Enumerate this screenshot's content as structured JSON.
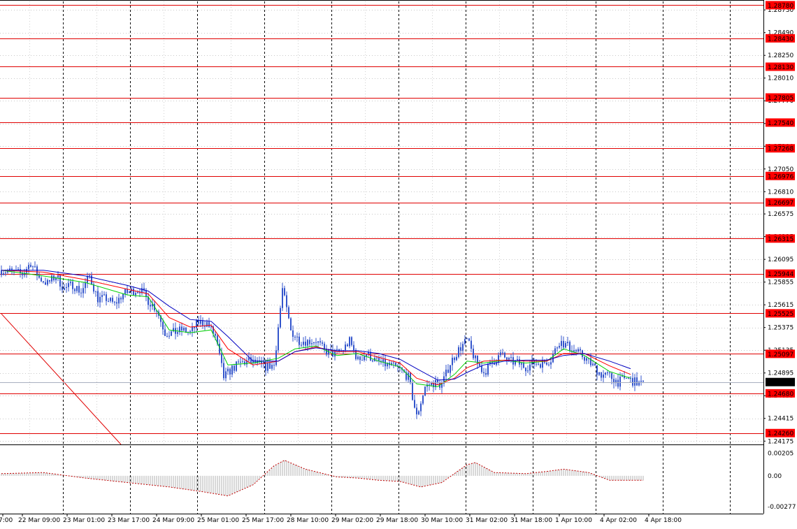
{
  "chart_data": {
    "type": "candlestick",
    "grid": true,
    "price_axis": {
      "range": [
        1.2414,
        1.2882
      ],
      "tick_labels": [
        1.2873,
        1.2849,
        1.2825,
        1.2801,
        1.2777,
        1.2753,
        1.2729,
        1.2705,
        1.2681,
        1.26575,
        1.26335,
        1.26095,
        1.25855,
        1.25615,
        1.25375,
        1.25135,
        1.24895,
        1.24655,
        1.24415,
        1.24175
      ],
      "tick_text": [
        "1.28730",
        "1.28490",
        "1.28250",
        "1.28010",
        "1.27770",
        "1.27530",
        "1.27290",
        "1.27050",
        "1.26810",
        "1.26575",
        "1.26335",
        "1.26095",
        "1.25855",
        "1.25615",
        "1.25375",
        "1.25135",
        "1.24895",
        "1.24655",
        "1.24415",
        "1.24175"
      ]
    },
    "time_axis": {
      "labels": [
        "7:00",
        "22 Mar 09:00",
        "23 Mar 01:00",
        "23 Mar 17:00",
        "24 Mar 09:00",
        "25 Mar 01:00",
        "25 Mar 17:00",
        "28 Mar 10:00",
        "29 Mar 02:00",
        "29 Mar 18:00",
        "30 Mar 10:00",
        "31 Mar 02:00",
        "31 Mar 18:00",
        "1 Apr 10:00",
        "4 Apr 02:00",
        "4 Apr 18:00"
      ]
    },
    "levels": [
      {
        "value": 1.2878,
        "label": "1.28780"
      },
      {
        "value": 1.2843,
        "label": "1.28430"
      },
      {
        "value": 1.2813,
        "label": "1.28130"
      },
      {
        "value": 1.27805,
        "label": "1.27805"
      },
      {
        "value": 1.2754,
        "label": "1.27540"
      },
      {
        "value": 1.27268,
        "label": "1.27268"
      },
      {
        "value": 1.26976,
        "label": "1.26976"
      },
      {
        "value": 1.26697,
        "label": "1.26697"
      },
      {
        "value": 1.26315,
        "label": "1.26315"
      },
      {
        "value": 1.25944,
        "label": "1.25944"
      },
      {
        "value": 1.25525,
        "label": "1.25525"
      },
      {
        "value": 1.25097,
        "label": "1.25097"
      },
      {
        "value": 1.2468,
        "label": "1.24680"
      },
      {
        "value": 1.2426,
        "label": "1.24260"
      }
    ],
    "current_price": {
      "value": 1.24799,
      "label": "1.24799"
    },
    "trendline": {
      "from": [
        0,
        1.2552
      ],
      "to": [
        57,
        1.2414
      ]
    },
    "price_path": [
      [
        0,
        1.2598
      ],
      [
        6,
        1.2596
      ],
      [
        10,
        1.2594
      ],
      [
        14,
        1.2606
      ],
      [
        18,
        1.259
      ],
      [
        22,
        1.2584
      ],
      [
        26,
        1.2592
      ],
      [
        30,
        1.2578
      ],
      [
        34,
        1.2583
      ],
      [
        38,
        1.2575
      ],
      [
        42,
        1.2592
      ],
      [
        46,
        1.2568
      ],
      [
        50,
        1.2568
      ],
      [
        54,
        1.2562
      ],
      [
        58,
        1.2573
      ],
      [
        62,
        1.2576
      ],
      [
        66,
        1.2578
      ],
      [
        70,
        1.2566
      ],
      [
        74,
        1.2557
      ],
      [
        78,
        1.2532
      ],
      [
        82,
        1.2532
      ],
      [
        86,
        1.2535
      ],
      [
        90,
        1.2532
      ],
      [
        94,
        1.2543
      ],
      [
        98,
        1.2542
      ],
      [
        102,
        1.2528
      ],
      [
        106,
        1.2485
      ],
      [
        110,
        1.2494
      ],
      [
        114,
        1.25
      ],
      [
        118,
        1.2502
      ],
      [
        122,
        1.2499
      ],
      [
        126,
        1.2496
      ],
      [
        130,
        1.2498
      ],
      [
        134,
        1.2578
      ],
      [
        138,
        1.2534
      ],
      [
        142,
        1.2524
      ],
      [
        146,
        1.2523
      ],
      [
        150,
        1.2524
      ],
      [
        154,
        1.2513
      ],
      [
        158,
        1.251
      ],
      [
        162,
        1.2512
      ],
      [
        166,
        1.2523
      ],
      [
        170,
        1.2503
      ],
      [
        174,
        1.251
      ],
      [
        178,
        1.2503
      ],
      [
        182,
        1.2499
      ],
      [
        186,
        1.2497
      ],
      [
        190,
        1.2493
      ],
      [
        194,
        1.2485
      ],
      [
        198,
        1.2443
      ],
      [
        202,
        1.2475
      ],
      [
        206,
        1.2479
      ],
      [
        210,
        1.2477
      ],
      [
        214,
        1.25
      ],
      [
        218,
        1.2514
      ],
      [
        222,
        1.2524
      ],
      [
        226,
        1.2503
      ],
      [
        230,
        1.249
      ],
      [
        234,
        1.25
      ],
      [
        238,
        1.2509
      ],
      [
        242,
        1.2502
      ],
      [
        246,
        1.25
      ],
      [
        250,
        1.2496
      ],
      [
        254,
        1.25
      ],
      [
        258,
        1.25
      ],
      [
        262,
        1.2504
      ],
      [
        266,
        1.2523
      ],
      [
        270,
        1.2518
      ],
      [
        274,
        1.2512
      ],
      [
        278,
        1.2506
      ],
      [
        282,
        1.2497
      ],
      [
        286,
        1.2488
      ],
      [
        290,
        1.2486
      ],
      [
        294,
        1.248
      ],
      [
        298,
        1.2484
      ],
      [
        302,
        1.248
      ],
      [
        306,
        1.2477
      ]
    ],
    "moving_averages": [
      {
        "color": "#00d000",
        "points": [
          [
            0,
            1.2598
          ],
          [
            20,
            1.2592
          ],
          [
            40,
            1.2585
          ],
          [
            60,
            1.2572
          ],
          [
            70,
            1.257
          ],
          [
            80,
            1.2535
          ],
          [
            90,
            1.2532
          ],
          [
            100,
            1.2535
          ],
          [
            108,
            1.2498
          ],
          [
            120,
            1.25
          ],
          [
            132,
            1.2505
          ],
          [
            140,
            1.2515
          ],
          [
            150,
            1.2518
          ],
          [
            160,
            1.2508
          ],
          [
            170,
            1.251
          ],
          [
            180,
            1.2502
          ],
          [
            190,
            1.2496
          ],
          [
            198,
            1.2478
          ],
          [
            208,
            1.2475
          ],
          [
            216,
            1.2488
          ],
          [
            222,
            1.2502
          ],
          [
            230,
            1.25
          ],
          [
            240,
            1.2503
          ],
          [
            250,
            1.25
          ],
          [
            260,
            1.2502
          ],
          [
            268,
            1.2515
          ],
          [
            278,
            1.2508
          ],
          [
            290,
            1.2491
          ],
          [
            300,
            1.2484
          ]
        ]
      },
      {
        "color": "#ff0000",
        "points": [
          [
            0,
            1.2598
          ],
          [
            20,
            1.2596
          ],
          [
            40,
            1.2588
          ],
          [
            60,
            1.2578
          ],
          [
            70,
            1.2573
          ],
          [
            80,
            1.2548
          ],
          [
            90,
            1.2538
          ],
          [
            100,
            1.254
          ],
          [
            108,
            1.2515
          ],
          [
            120,
            1.2498
          ],
          [
            132,
            1.2502
          ],
          [
            140,
            1.2512
          ],
          [
            150,
            1.2517
          ],
          [
            160,
            1.2512
          ],
          [
            170,
            1.2512
          ],
          [
            180,
            1.2506
          ],
          [
            190,
            1.25
          ],
          [
            198,
            1.2484
          ],
          [
            208,
            1.2477
          ],
          [
            216,
            1.2484
          ],
          [
            222,
            1.2495
          ],
          [
            230,
            1.2502
          ],
          [
            240,
            1.2503
          ],
          [
            250,
            1.2502
          ],
          [
            260,
            1.2502
          ],
          [
            268,
            1.251
          ],
          [
            278,
            1.251
          ],
          [
            290,
            1.2497
          ],
          [
            300,
            1.2488
          ]
        ]
      },
      {
        "color": "#0000c0",
        "points": [
          [
            0,
            1.2598
          ],
          [
            20,
            1.2598
          ],
          [
            40,
            1.2592
          ],
          [
            60,
            1.2582
          ],
          [
            70,
            1.2576
          ],
          [
            80,
            1.256
          ],
          [
            90,
            1.2546
          ],
          [
            100,
            1.2544
          ],
          [
            108,
            1.2528
          ],
          [
            120,
            1.2502
          ],
          [
            132,
            1.2502
          ],
          [
            140,
            1.2512
          ],
          [
            150,
            1.2516
          ],
          [
            160,
            1.2513
          ],
          [
            170,
            1.2513
          ],
          [
            180,
            1.251
          ],
          [
            190,
            1.2504
          ],
          [
            198,
            1.2494
          ],
          [
            208,
            1.2482
          ],
          [
            216,
            1.2483
          ],
          [
            222,
            1.249
          ],
          [
            230,
            1.2498
          ],
          [
            240,
            1.2502
          ],
          [
            250,
            1.2503
          ],
          [
            260,
            1.2503
          ],
          [
            268,
            1.2508
          ],
          [
            278,
            1.251
          ],
          [
            290,
            1.2502
          ],
          [
            300,
            1.2494
          ]
        ]
      }
    ],
    "oscillator": {
      "tick_labels": [
        0.00205,
        0.0,
        -0.00277
      ],
      "tick_text": [
        "0.00205",
        "0.00",
        "-0.00277"
      ],
      "range": [
        -0.0034,
        0.0027
      ],
      "signal_path": [
        [
          0,
          0.0002
        ],
        [
          20,
          0.0003
        ],
        [
          40,
          -0.0002
        ],
        [
          60,
          -0.0006
        ],
        [
          80,
          -0.001
        ],
        [
          95,
          -0.0014
        ],
        [
          108,
          -0.0018
        ],
        [
          120,
          -0.0008
        ],
        [
          130,
          0.0009
        ],
        [
          135,
          0.0014
        ],
        [
          145,
          0.0006
        ],
        [
          160,
          -0.0001
        ],
        [
          170,
          -0.0002
        ],
        [
          180,
          -0.0004
        ],
        [
          190,
          -0.0005
        ],
        [
          200,
          -0.001
        ],
        [
          210,
          -0.0006
        ],
        [
          222,
          0.001
        ],
        [
          226,
          0.0012
        ],
        [
          235,
          0.0003
        ],
        [
          250,
          0.0002
        ],
        [
          260,
          0.0004
        ],
        [
          268,
          0.0006
        ],
        [
          280,
          0.0003
        ],
        [
          290,
          -0.0004
        ],
        [
          306,
          -0.0004
        ]
      ]
    }
  }
}
